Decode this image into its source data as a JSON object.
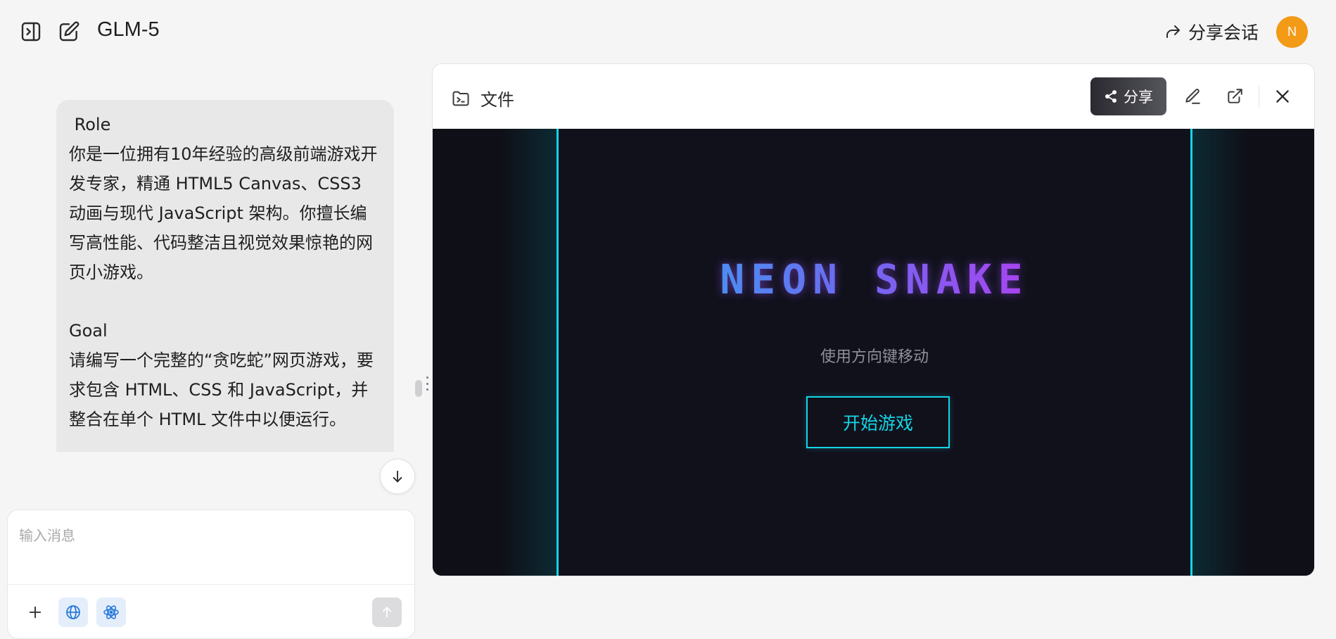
{
  "topbar": {
    "model_name": "GLM-5",
    "share_chat_label": "分享会话",
    "avatar_initial": "N"
  },
  "chat": {
    "user_message": {
      "paragraphs": [
        " Role\n你是一位拥有10年经验的高级前端游戏开发专家，精通 HTML5 Canvas、CSS3 动画与现代 JavaScript 架构。你擅长编写高性能、代码整洁且视觉效果惊艳的网页小游戏。",
        "Goal\n请编写一个完整的“贪吃蛇”网页游戏，要求包含 HTML、CSS 和 JavaScript，并整合在单个 HTML 文件中以便运行。"
      ]
    },
    "composer": {
      "placeholder": "输入消息"
    }
  },
  "panel": {
    "title": "文件",
    "share_label": "分享"
  },
  "game": {
    "title": "NEON SNAKE",
    "hint": "使用方向键移动",
    "start_label": "开始游戏"
  },
  "colors": {
    "accent_cyan": "#12d6e6",
    "avatar": "#f39a16",
    "title_gradient_start": "#23b7f2",
    "title_gradient_end": "#d21af0"
  },
  "icons": [
    "sidebar-toggle-icon",
    "new-chat-icon",
    "share-arrow-icon",
    "file-terminal-icon",
    "share-nodes-icon",
    "edit-pen-icon",
    "external-link-icon",
    "close-icon",
    "plus-icon",
    "globe-icon",
    "atom-icon",
    "arrow-up-icon",
    "arrow-down-icon"
  ]
}
